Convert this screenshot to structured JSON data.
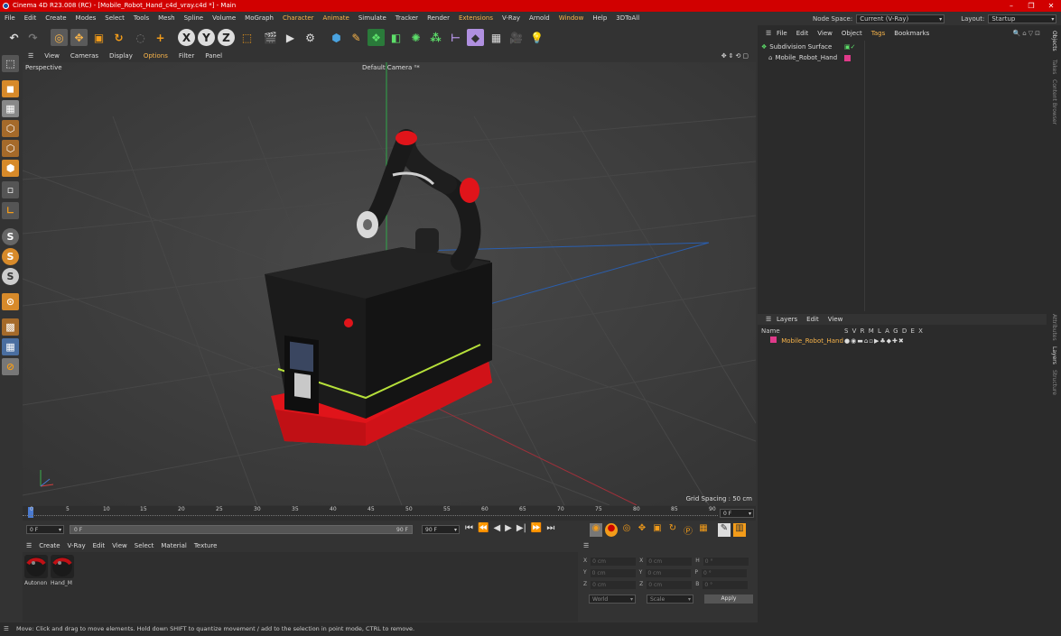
{
  "app": {
    "title": "Cinema 4D R23.008 (RC) - [Mobile_Robot_Hand_c4d_vray.c4d *] - Main"
  },
  "menubar": [
    "File",
    "Edit",
    "Create",
    "Modes",
    "Select",
    "Tools",
    "Mesh",
    "Spline",
    "Volume",
    "MoGraph",
    "Character",
    "Animate",
    "Simulate",
    "Tracker",
    "Render",
    "Extensions",
    "V-Ray",
    "Arnold",
    "Window",
    "Help",
    "3DToAll"
  ],
  "nodespace": {
    "label": "Node Space:",
    "value": "Current (V-Ray)"
  },
  "layout": {
    "label": "Layout:",
    "value": "Startup"
  },
  "viewport": {
    "menu": [
      "View",
      "Cameras",
      "Display",
      "Options",
      "Filter",
      "Panel"
    ],
    "label": "Perspective",
    "camera": "Default Camera ⁰*",
    "grid_spacing": "Grid Spacing : 50 cm"
  },
  "timeline": {
    "ticks": [
      "0",
      "5",
      "10",
      "15",
      "20",
      "25",
      "30",
      "35",
      "40",
      "45",
      "50",
      "55",
      "60",
      "65",
      "70",
      "75",
      "80",
      "85",
      "90"
    ],
    "current_frame": "0 F",
    "start": "0 F",
    "range_start": "0 F",
    "range_end": "90 F",
    "end": "90 F"
  },
  "materials": {
    "menu": [
      "Create",
      "V-Ray",
      "Edit",
      "View",
      "Select",
      "Material",
      "Texture"
    ],
    "items": [
      "Autonon",
      "Hand_M"
    ]
  },
  "coords": {
    "rows": [
      {
        "a": "X",
        "av": "0 cm",
        "b": "X",
        "bv": "0 cm",
        "c": "H",
        "cv": "0 °"
      },
      {
        "a": "Y",
        "av": "0 cm",
        "b": "Y",
        "bv": "0 cm",
        "c": "P",
        "cv": "0 °"
      },
      {
        "a": "Z",
        "av": "0 cm",
        "b": "Z",
        "bv": "0 cm",
        "c": "B",
        "cv": "0 °"
      }
    ],
    "mode": "World",
    "scale": "Scale",
    "apply": "Apply"
  },
  "objects": {
    "menu": [
      "File",
      "Edit",
      "View",
      "Object",
      "Tags",
      "Bookmarks"
    ],
    "items": [
      "Subdivision Surface",
      "Mobile_Robot_Hand"
    ]
  },
  "layers": {
    "menu": [
      "Layers",
      "Edit",
      "View"
    ],
    "header_name": "Name",
    "header_cols": "S V R M L A G D E X",
    "item": "Mobile_Robot_Hand"
  },
  "sidetabs": [
    "Objects",
    "Takes",
    "Content Browser",
    "Attributes",
    "Layers",
    "Structure"
  ],
  "status": "Move: Click and drag to move elements. Hold down SHIFT to quantize movement / add to the selection in point mode, CTRL to remove.",
  "colors": {
    "title_red": "#d10000",
    "accent_orange": "#f8b44a",
    "robot_red": "#e0141a"
  }
}
